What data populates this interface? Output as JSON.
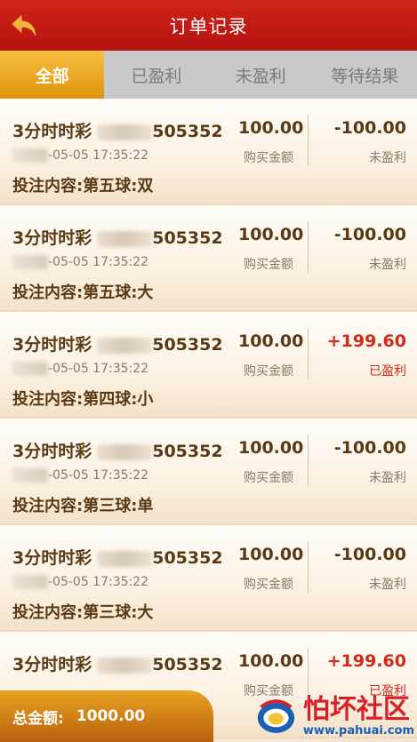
{
  "header": {
    "title": "订单记录"
  },
  "tabs": [
    {
      "label": "全部",
      "active": true
    },
    {
      "label": "已盈利",
      "active": false
    },
    {
      "label": "未盈利",
      "active": false
    },
    {
      "label": "等待结果",
      "active": false
    }
  ],
  "orders": [
    {
      "lottery": "3分时时彩",
      "issue_suffix": "505352",
      "time": "-05-05 17:35:22",
      "content": "投注内容:第五球:双",
      "amount": "100.00",
      "amount_label": "购买金额",
      "profit": "-100.00",
      "status": "未盈利",
      "win": false
    },
    {
      "lottery": "3分时时彩",
      "issue_suffix": "505352",
      "time": "-05-05 17:35:22",
      "content": "投注内容:第五球:大",
      "amount": "100.00",
      "amount_label": "购买金额",
      "profit": "-100.00",
      "status": "未盈利",
      "win": false
    },
    {
      "lottery": "3分时时彩",
      "issue_suffix": "505352",
      "time": "-05-05 17:35:22",
      "content": "投注内容:第四球:小",
      "amount": "100.00",
      "amount_label": "购买金额",
      "profit": "+199.60",
      "status": "已盈利",
      "win": true
    },
    {
      "lottery": "3分时时彩",
      "issue_suffix": "505352",
      "time": "-05-05 17:35:22",
      "content": "投注内容:第三球:单",
      "amount": "100.00",
      "amount_label": "购买金额",
      "profit": "-100.00",
      "status": "未盈利",
      "win": false
    },
    {
      "lottery": "3分时时彩",
      "issue_suffix": "505352",
      "time": "-05-05 17:35:22",
      "content": "投注内容:第三球:大",
      "amount": "100.00",
      "amount_label": "购买金额",
      "profit": "-100.00",
      "status": "未盈利",
      "win": false
    },
    {
      "lottery": "3分时时彩",
      "issue_suffix": "505352",
      "time": "",
      "content": "",
      "amount": "100.00",
      "amount_label": "购买金额",
      "profit": "+199.60",
      "status": "已盈利",
      "win": true
    }
  ],
  "footer": {
    "total_label": "总金额:",
    "total_value": "1000.00"
  },
  "watermark": {
    "name": "怕坏社区",
    "url": "www.pahuai.com"
  },
  "colors": {
    "header": "#c41a14",
    "tab_active": "#eba82a",
    "win": "#d02a1e",
    "text": "#5a3a14"
  }
}
